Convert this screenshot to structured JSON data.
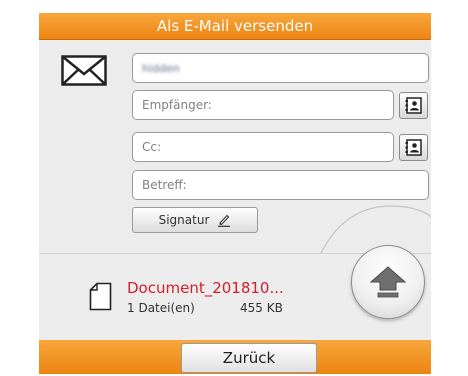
{
  "window": {
    "title": "Als E-Mail versenden"
  },
  "form": {
    "from_value": "hidden",
    "to_placeholder": "Empfänger:",
    "cc_placeholder": "Cc:",
    "subject_placeholder": "Betreff:",
    "signature_label": "Signatur"
  },
  "attachment": {
    "name": "Document_201810...",
    "count": "1 Datei(en)",
    "size": "455 KB"
  },
  "footer": {
    "back_label": "Zurück"
  },
  "colors": {
    "accent": "#f09a2c",
    "filename": "#d0202a"
  },
  "icons": {
    "envelope": "envelope-icon",
    "address_book": "address-book-icon",
    "pen": "pen-icon",
    "upload": "upload-arrow-icon",
    "document": "document-icon"
  }
}
